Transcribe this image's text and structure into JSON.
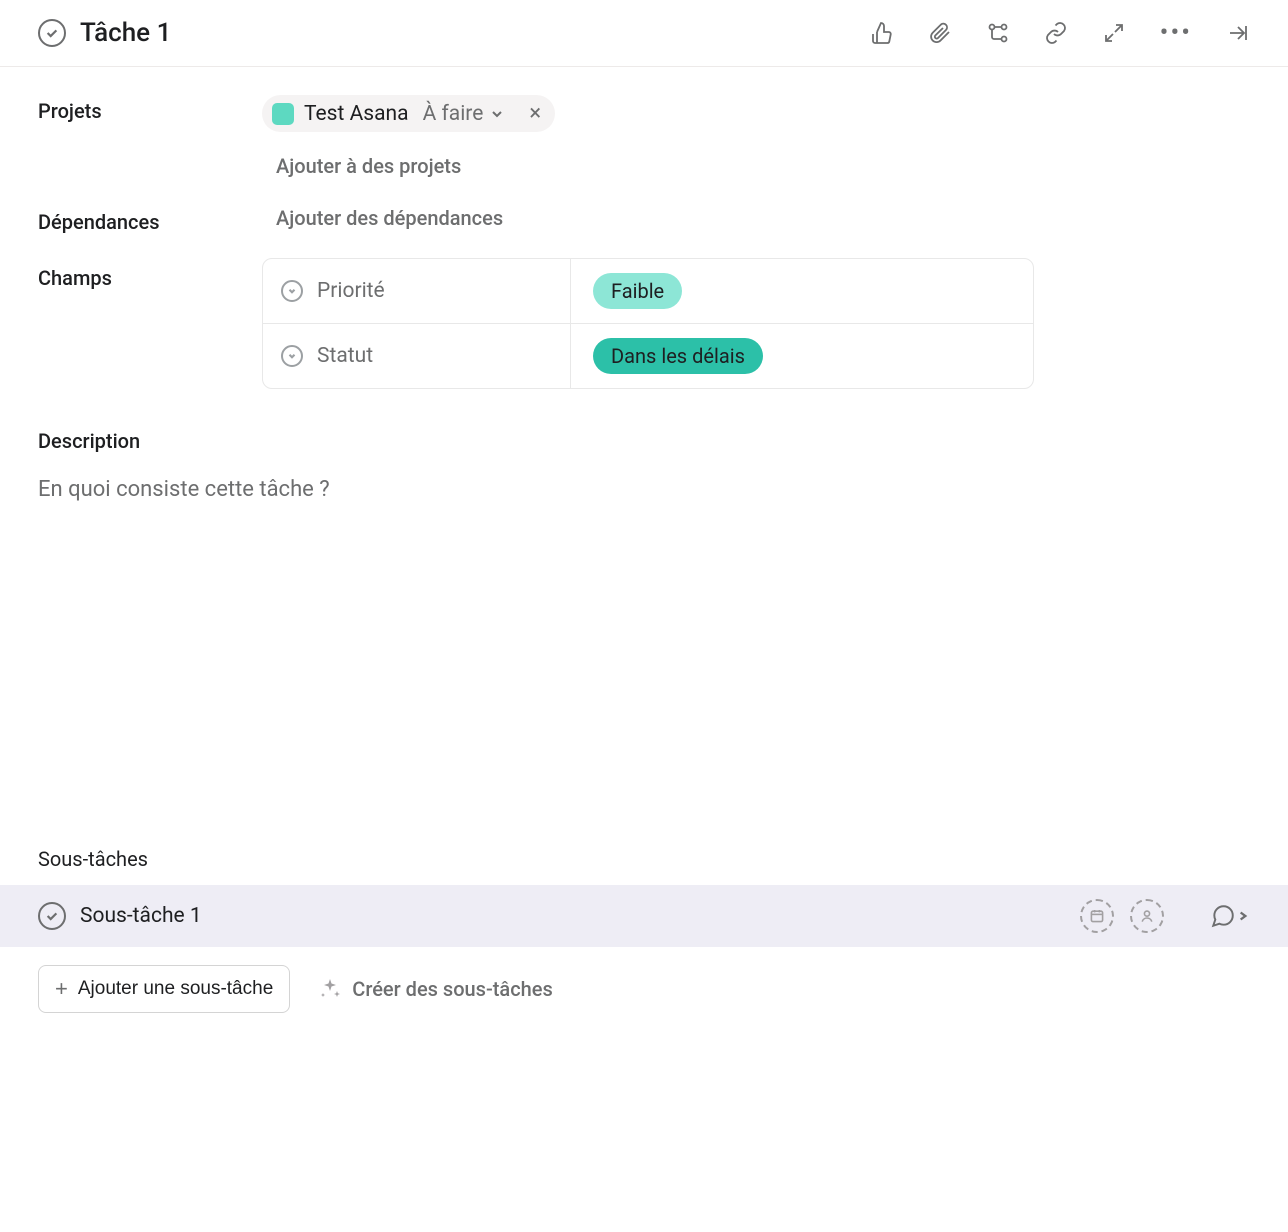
{
  "task": {
    "title": "Tâche 1"
  },
  "projects": {
    "label": "Projets",
    "chip_name": "Test Asana",
    "chip_status": "À faire",
    "add_link": "Ajouter à des projets"
  },
  "dependencies": {
    "label": "Dépendances",
    "placeholder": "Ajouter des dépendances"
  },
  "fields": {
    "label": "Champs",
    "priority": {
      "name": "Priorité",
      "value": "Faible"
    },
    "status": {
      "name": "Statut",
      "value": "Dans les délais"
    }
  },
  "description": {
    "label": "Description",
    "placeholder": "En quoi consiste cette tâche ?"
  },
  "subtasks": {
    "label": "Sous-tâches",
    "item_title": "Sous-tâche 1",
    "add_button": "Ajouter une sous-tâche",
    "create_button": "Créer des sous-tâches"
  }
}
